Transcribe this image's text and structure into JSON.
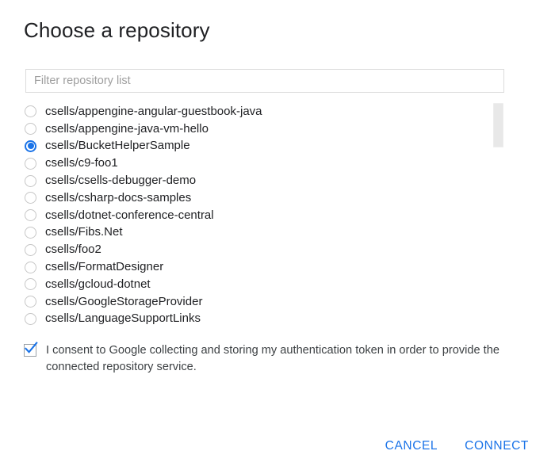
{
  "dialog": {
    "title": "Choose a repository"
  },
  "filter": {
    "placeholder": "Filter repository list",
    "value": ""
  },
  "repositories": {
    "selected": "csells/BucketHelperSample",
    "items": [
      {
        "label": "csells/appengine-angular-guestbook-java",
        "selected": false
      },
      {
        "label": "csells/appengine-java-vm-hello",
        "selected": false
      },
      {
        "label": "csells/BucketHelperSample",
        "selected": true
      },
      {
        "label": "csells/c9-foo1",
        "selected": false
      },
      {
        "label": "csells/csells-debugger-demo",
        "selected": false
      },
      {
        "label": "csells/csharp-docs-samples",
        "selected": false
      },
      {
        "label": "csells/dotnet-conference-central",
        "selected": false
      },
      {
        "label": "csells/Fibs.Net",
        "selected": false
      },
      {
        "label": "csells/foo2",
        "selected": false
      },
      {
        "label": "csells/FormatDesigner",
        "selected": false
      },
      {
        "label": "csells/gcloud-dotnet",
        "selected": false
      },
      {
        "label": "csells/GoogleStorageProvider",
        "selected": false
      },
      {
        "label": "csells/LanguageSupportLinks",
        "selected": false
      }
    ]
  },
  "consent": {
    "checked": true,
    "text": "I consent to Google collecting and storing my authentication token in order to provide the connected repository service."
  },
  "actions": {
    "cancel_label": "CANCEL",
    "connect_label": "CONNECT"
  },
  "colors": {
    "accent": "#1a73e8",
    "text": "#202124",
    "placeholder": "#9e9e9e",
    "border": "#dcdcdc",
    "radio_border": "#c6c6c6",
    "scrollbar_thumb": "#e8e8e8"
  }
}
